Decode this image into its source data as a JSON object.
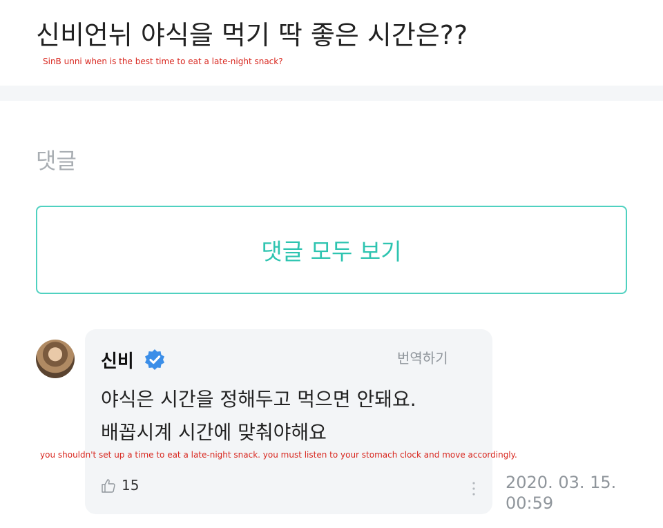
{
  "post": {
    "title": "신비언뉘 야식을 먹기 딱 좋은 시간은??",
    "translation": "SinB unni when is the best time to eat a late-night snack?"
  },
  "comments_section": {
    "label": "댓글",
    "view_all_label": "댓글 모두 보기"
  },
  "comment": {
    "author": "신비",
    "verified_icon": "verified-check-icon",
    "translate_label": "번역하기",
    "text_line_1": "야식은 시간을 정해두고 먹으면 안돼요.",
    "text_line_2": "배꼽시계 시간에 맞춰야해요",
    "translation": "you shouldn't set up a time to eat a late-night snack. you must listen to your stomach clock and move accordingly.",
    "like_icon": "thumbs-up-icon",
    "like_count": "15",
    "more_icon": "more-vertical-icon",
    "date": "2020. 03. 15.",
    "time": "00:59"
  },
  "colors": {
    "accent": "#2ec4b0",
    "annotation": "#d8261e",
    "verified": "#3b8ee8"
  }
}
